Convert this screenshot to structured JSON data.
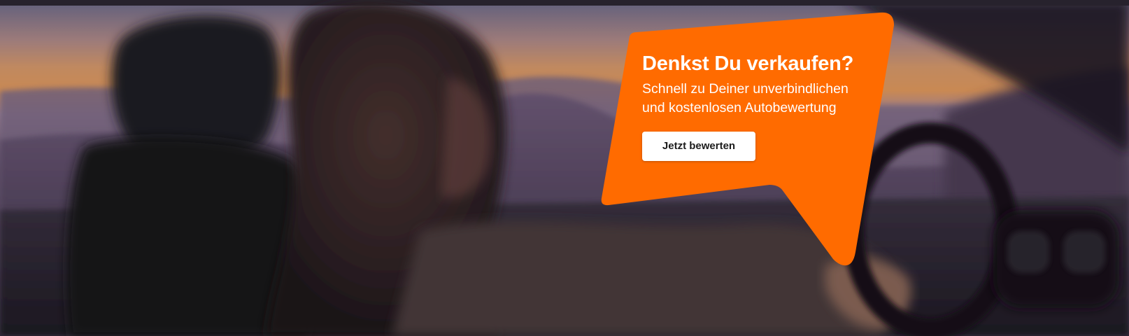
{
  "hero": {
    "image_icon": "woman-driving-car-at-sunset",
    "bubble": {
      "color": "#ff6b00",
      "headline": "Denkst Du verkaufen?",
      "subline_line1": "Schnell zu Deiner unverbindlichen",
      "subline_line2": "und kostenlosen Autobewertung",
      "cta_label": "Jetzt bewerten"
    }
  }
}
